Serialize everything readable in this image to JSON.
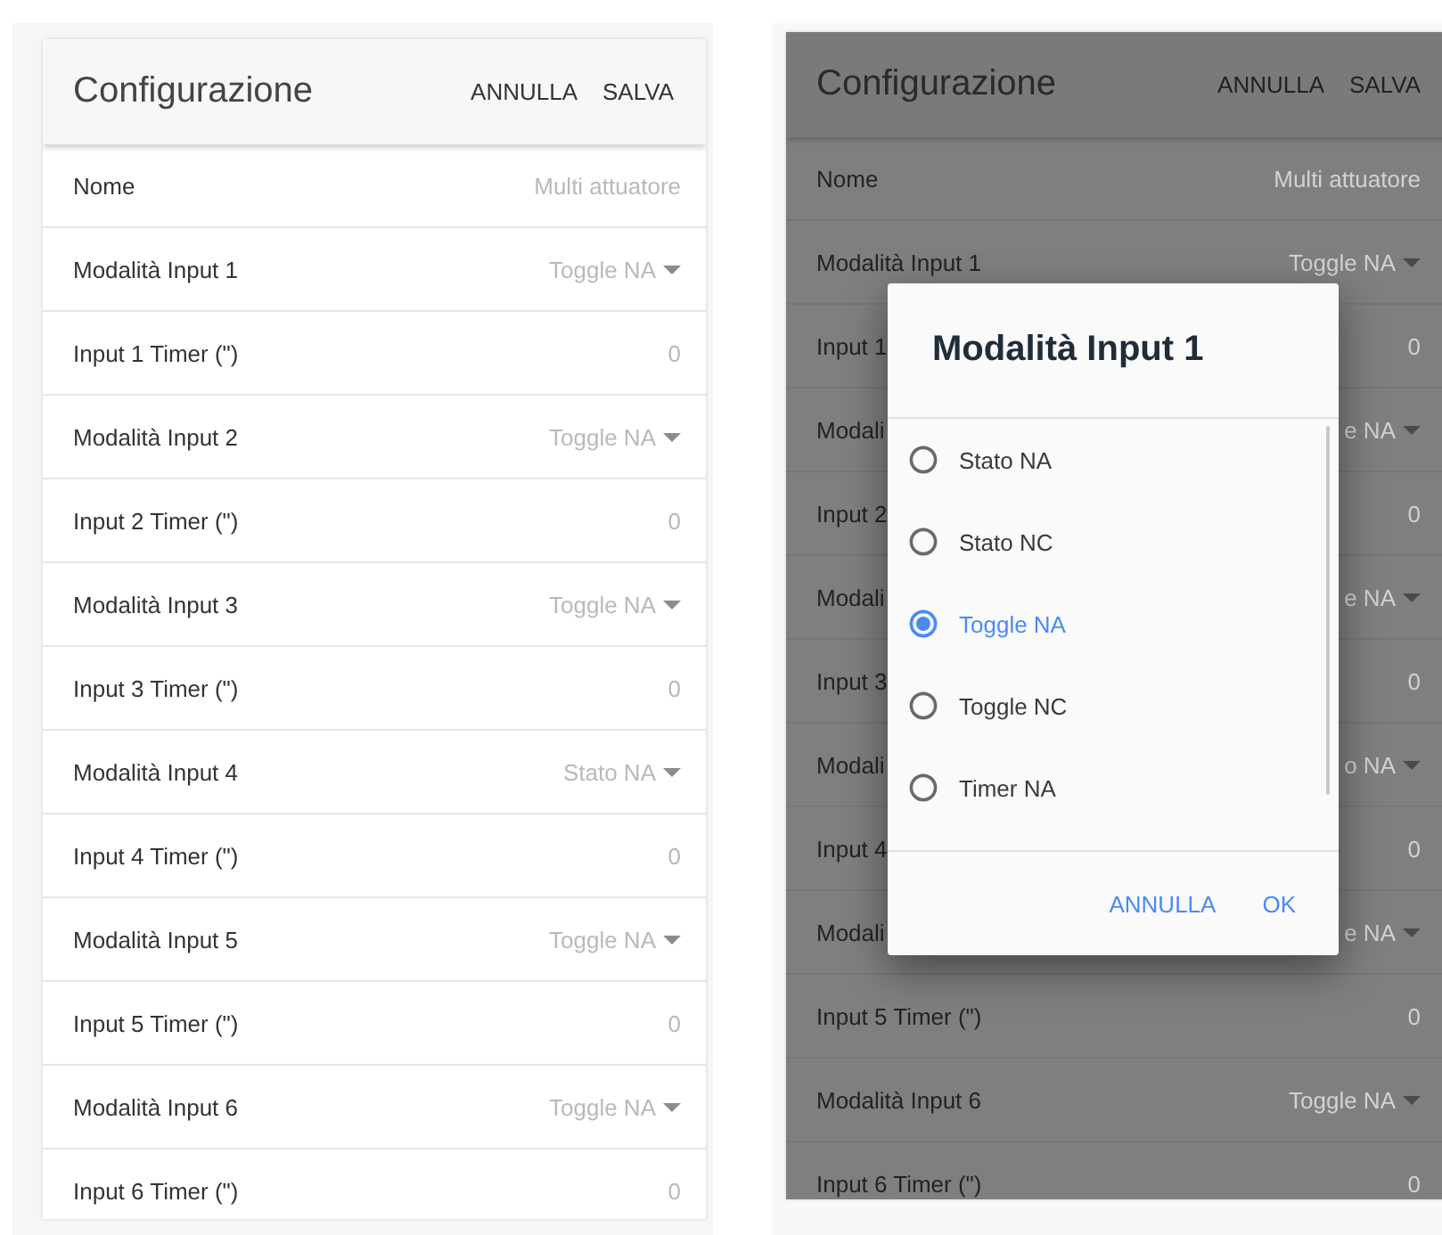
{
  "screens": [
    {
      "dimmed": false,
      "title": "Configurazione",
      "actions": [
        "ANNULLA",
        "SALVA"
      ],
      "rows": [
        {
          "kind": "field",
          "label": "Nome",
          "value": "Multi attuatore"
        },
        {
          "kind": "select",
          "label": "Modalità Input 1",
          "value": "Toggle NA"
        },
        {
          "kind": "field",
          "label": "Input 1 Timer (\")",
          "value": "0"
        },
        {
          "kind": "select",
          "label": "Modalità Input 2",
          "value": "Toggle NA"
        },
        {
          "kind": "field",
          "label": "Input 2 Timer (\")",
          "value": "0"
        },
        {
          "kind": "select",
          "label": "Modalità Input 3",
          "value": "Toggle NA"
        },
        {
          "kind": "field",
          "label": "Input 3 Timer (\")",
          "value": "0"
        },
        {
          "kind": "select",
          "label": "Modalità Input 4",
          "value": "Stato NA"
        },
        {
          "kind": "field",
          "label": "Input 4 Timer (\")",
          "value": "0"
        },
        {
          "kind": "select",
          "label": "Modalità Input 5",
          "value": "Toggle NA"
        },
        {
          "kind": "field",
          "label": "Input 5 Timer (\")",
          "value": "0"
        },
        {
          "kind": "select",
          "label": "Modalità Input 6",
          "value": "Toggle NA"
        },
        {
          "kind": "field",
          "label": "Input 6 Timer (\")",
          "value": "0"
        }
      ]
    },
    {
      "dimmed": true,
      "title": "Configurazione",
      "actions": [
        "ANNULLA",
        "SALVA"
      ],
      "rows": [
        {
          "kind": "field",
          "label": "Nome",
          "value": "Multi attuatore"
        },
        {
          "kind": "select",
          "label": "Modalità Input 1",
          "value": "Toggle NA"
        },
        {
          "kind": "field",
          "label": "Input 1",
          "value": "0"
        },
        {
          "kind": "select",
          "label": "Modali",
          "value": "e NA"
        },
        {
          "kind": "field",
          "label": "Input 2",
          "value": "0"
        },
        {
          "kind": "select",
          "label": "Modali",
          "value": "e NA"
        },
        {
          "kind": "field",
          "label": "Input 3",
          "value": "0"
        },
        {
          "kind": "select",
          "label": "Modali",
          "value": "o NA"
        },
        {
          "kind": "field",
          "label": "Input 4",
          "value": "0"
        },
        {
          "kind": "select",
          "label": "Modali",
          "value": "e NA"
        },
        {
          "kind": "field",
          "label": "Input 5 Timer (\")",
          "value": "0"
        },
        {
          "kind": "select",
          "label": "Modalità Input 6",
          "value": "Toggle NA"
        },
        {
          "kind": "field",
          "label": "Input 6 Timer (\")",
          "value": "0"
        }
      ],
      "dialog": {
        "title": "Modalità Input 1",
        "options": [
          {
            "label": "Stato NA",
            "selected": false
          },
          {
            "label": "Stato NC",
            "selected": false
          },
          {
            "label": "Toggle NA",
            "selected": true
          },
          {
            "label": "Toggle NC",
            "selected": false
          },
          {
            "label": "Timer NA",
            "selected": false
          }
        ],
        "buttons": [
          "ANNULLA",
          "OK"
        ]
      }
    }
  ]
}
